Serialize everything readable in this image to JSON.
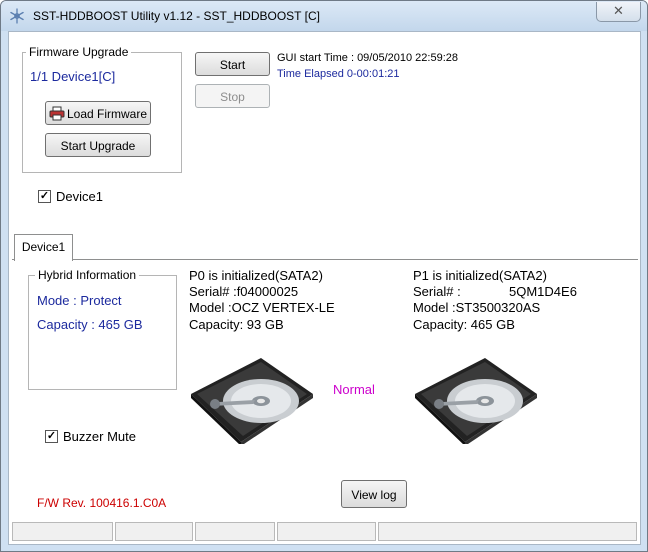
{
  "window": {
    "title": "SST-HDDBOOST Utility v1.12 - SST_HDDBOOST [C]",
    "close_glyph": "✕"
  },
  "firmware": {
    "group_label": "Firmware Upgrade",
    "device_info": "1/1 Device1[C]",
    "load_label": "Load Firmware",
    "upgrade_label": "Start Upgrade",
    "device_check_label": "Device1",
    "device_checked": true
  },
  "controls": {
    "start_label": "Start",
    "stop_label": "Stop"
  },
  "timing": {
    "start_time": "GUI start Time : 09/05/2010 22:59:28",
    "elapsed": "Time Elapsed 0-00:01:21"
  },
  "tab": {
    "label": "Device1"
  },
  "hybrid": {
    "group_label": "Hybrid Information",
    "mode": "Mode : Protect",
    "capacity": "Capacity : 465 GB"
  },
  "p0": {
    "status": "P0 is initialized(SATA2)",
    "serial": "Serial# :f04000025",
    "model": "Model :OCZ VERTEX-LE",
    "capacity": "Capacity: 93 GB"
  },
  "p1": {
    "status": "P1 is initialized(SATA2)",
    "serial_label": "Serial# :",
    "serial_value": "5QM1D4E6",
    "model": "Model :ST3500320AS",
    "capacity": "Capacity: 465 GB"
  },
  "normal_status": "Normal",
  "buzzer": {
    "label": "Buzzer Mute",
    "checked": true
  },
  "fw_rev": "F/W Rev. 100416.1.C0A",
  "view_log_label": "View log",
  "colors": {
    "accent_blue": "#1c2a9e",
    "normal": "#cc00cc",
    "fw_rev": "#cc0000"
  }
}
